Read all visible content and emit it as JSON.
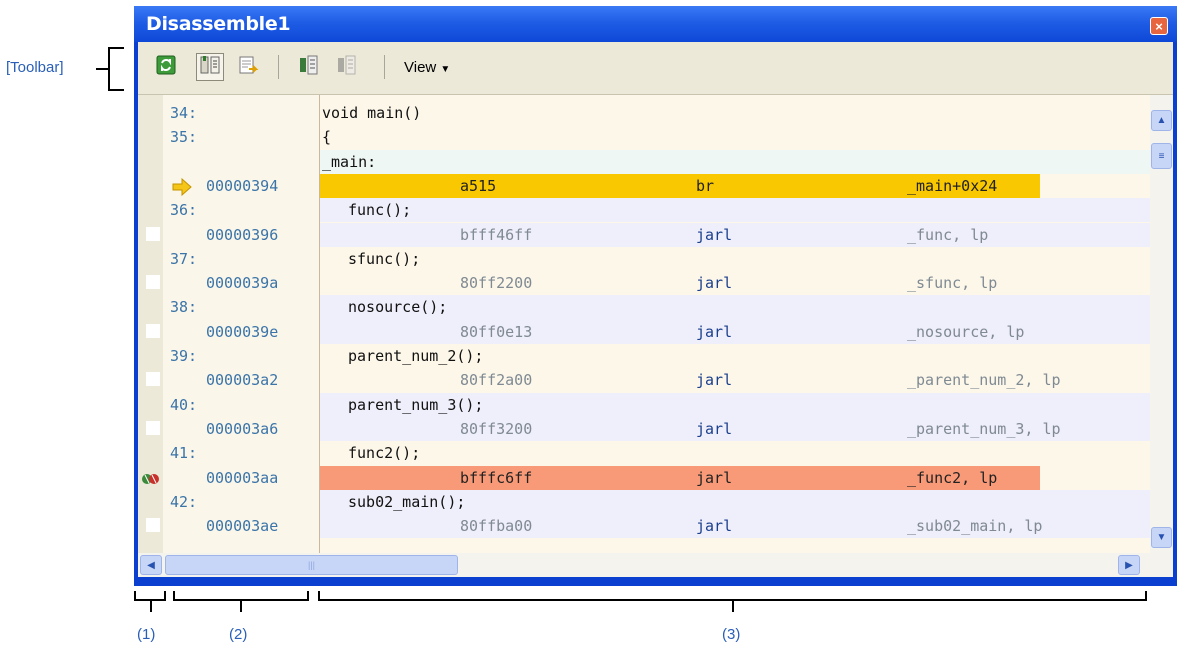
{
  "window": {
    "title": "Disassemble1",
    "close_symbol": "×"
  },
  "toolbar": {
    "view_label": "View",
    "icons": [
      "refresh-icon",
      "toggle-source-icon",
      "output-icon",
      "jump-to-address-icon",
      "symbol-display-icon"
    ]
  },
  "callouts": {
    "toolbar": "[Toolbar]",
    "area1": "(1)",
    "area2": "(2)",
    "area3": "(3)"
  },
  "rows": [
    {
      "line": "34:",
      "addr": "",
      "src": "void main()",
      "hex": "",
      "mnem": "",
      "oper": "",
      "style": "odd"
    },
    {
      "line": "35:",
      "addr": "",
      "src": "{",
      "hex": "",
      "mnem": "",
      "oper": "",
      "style": "odd"
    },
    {
      "line": "",
      "addr": "",
      "src": "_main:",
      "hex": "",
      "mnem": "",
      "oper": "",
      "style": "label"
    },
    {
      "line": "",
      "addr": "00000394",
      "src": "",
      "hex": "a515",
      "mnem": "br",
      "oper": "_main+0x24",
      "style": "current",
      "mark": "arrow-icon"
    },
    {
      "line": "36:",
      "addr": "",
      "src": "func();",
      "hex": "",
      "mnem": "",
      "oper": "",
      "style": "even"
    },
    {
      "line": "",
      "addr": "00000396",
      "src": "",
      "hex": "bfff46ff",
      "mnem": "jarl",
      "oper": "_func, lp",
      "style": "even"
    },
    {
      "line": "37:",
      "addr": "",
      "src": "sfunc();",
      "hex": "",
      "mnem": "",
      "oper": "",
      "style": "odd"
    },
    {
      "line": "",
      "addr": "0000039a",
      "src": "",
      "hex": "80ff2200",
      "mnem": "jarl",
      "oper": "_sfunc, lp",
      "style": "odd"
    },
    {
      "line": "38:",
      "addr": "",
      "src": "nosource();",
      "hex": "",
      "mnem": "",
      "oper": "",
      "style": "even"
    },
    {
      "line": "",
      "addr": "0000039e",
      "src": "",
      "hex": "80ff0e13",
      "mnem": "jarl",
      "oper": "_nosource, lp",
      "style": "even"
    },
    {
      "line": "39:",
      "addr": "",
      "src": "parent_num_2();",
      "hex": "",
      "mnem": "",
      "oper": "",
      "style": "odd"
    },
    {
      "line": "",
      "addr": "000003a2",
      "src": "",
      "hex": "80ff2a00",
      "mnem": "jarl",
      "oper": "_parent_num_2, lp",
      "style": "odd"
    },
    {
      "line": "40:",
      "addr": "",
      "src": "parent_num_3();",
      "hex": "",
      "mnem": "",
      "oper": "",
      "style": "even"
    },
    {
      "line": "",
      "addr": "000003a6",
      "src": "",
      "hex": "80ff3200",
      "mnem": "jarl",
      "oper": "_parent_num_3, lp",
      "style": "even"
    },
    {
      "line": "41:",
      "addr": "",
      "src": "func2();",
      "hex": "",
      "mnem": "",
      "oper": "",
      "style": "odd"
    },
    {
      "line": "",
      "addr": "000003aa",
      "src": "",
      "hex": "bfffc6ff",
      "mnem": "jarl",
      "oper": "_func2, lp",
      "style": "breakpoint",
      "mark": "breakpoint-icon"
    },
    {
      "line": "42:",
      "addr": "",
      "src": "sub02_main();",
      "hex": "",
      "mnem": "",
      "oper": "",
      "style": "even"
    },
    {
      "line": "",
      "addr": "000003ae",
      "src": "",
      "hex": "80ffba00",
      "mnem": "jarl",
      "oper": "_sub02_main, lp",
      "style": "even"
    }
  ],
  "colors": {
    "current_highlight": "#f9c800",
    "breakpoint_highlight": "#f89a78",
    "callout_blue": "#2a5fb8"
  }
}
